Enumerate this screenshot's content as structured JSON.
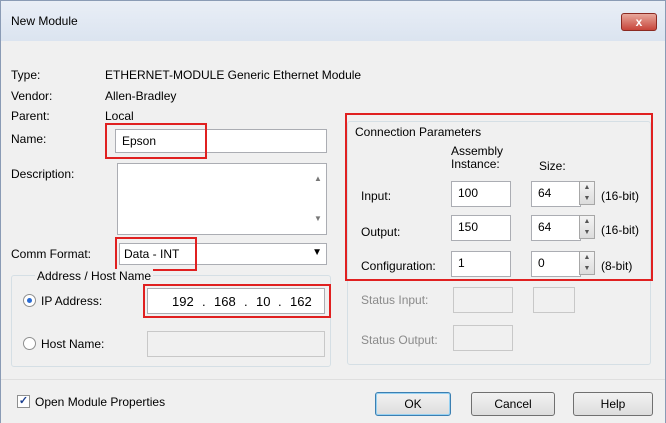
{
  "window": {
    "title": "New Module",
    "close_label": "x"
  },
  "info": {
    "type_label": "Type:",
    "type_value": "ETHERNET-MODULE Generic Ethernet Module",
    "vendor_label": "Vendor:",
    "vendor_value": "Allen-Bradley",
    "parent_label": "Parent:",
    "parent_value": "Local"
  },
  "name": {
    "label": "Name:",
    "value": "Epson"
  },
  "description": {
    "label": "Description:",
    "value": ""
  },
  "comm_format": {
    "label": "Comm Format:",
    "value": "Data - INT"
  },
  "address": {
    "group_label": "Address / Host Name",
    "ip_label": "IP Address:",
    "ip_octets": [
      "192",
      "168",
      "10",
      "162"
    ],
    "host_label": "Host Name:",
    "host_value": ""
  },
  "connection": {
    "group_label": "Connection Parameters",
    "col_assembly": "Assembly Instance:",
    "col_size": "Size:",
    "rows": [
      {
        "label": "Input:",
        "instance": "100",
        "size": "64",
        "unit": "(16-bit)"
      },
      {
        "label": "Output:",
        "instance": "150",
        "size": "64",
        "unit": "(16-bit)"
      },
      {
        "label": "Configuration:",
        "instance": "1",
        "size": "0",
        "unit": "(8-bit)"
      }
    ],
    "status_input_label": "Status Input:",
    "status_output_label": "Status Output:"
  },
  "footer": {
    "open_props_label": "Open Module Properties",
    "open_props_checked": true,
    "ok_label": "OK",
    "cancel_label": "Cancel",
    "help_label": "Help"
  },
  "colors": {
    "highlight": "#e02020",
    "radio_selected": "#2a6bd2"
  }
}
